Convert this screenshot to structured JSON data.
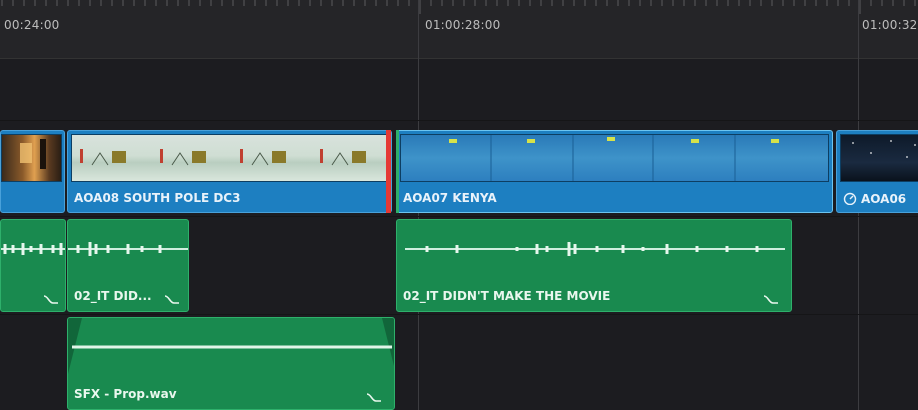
{
  "ruler": {
    "timecodes": [
      "00:24:00",
      "01:00:28:00",
      "01:00:32"
    ]
  },
  "video_track": {
    "clips": [
      {
        "label": "",
        "thumb": "orange-interior"
      },
      {
        "label": "AOA08 SOUTH POLE DC3",
        "thumb": "snowfield"
      },
      {
        "label": "AOA07 KENYA",
        "thumb": "blue-water"
      },
      {
        "label": "AOA06",
        "icon": "speed-gauge-icon",
        "thumb": "night-sky"
      }
    ]
  },
  "audio_track_1": {
    "clips": [
      {
        "label": ""
      },
      {
        "label": "02_IT DID..."
      },
      {
        "label": "02_IT DIDN'T MAKE THE MOVIE"
      }
    ]
  },
  "audio_track_2": {
    "clips": [
      {
        "label": "SFX - Prop.wav"
      }
    ]
  },
  "colors": {
    "background": "#1c1c20",
    "video_clip": "#1d7fc1",
    "audio_clip": "#198a4f",
    "marker": "#e53935",
    "accent": "#2eb06b"
  }
}
